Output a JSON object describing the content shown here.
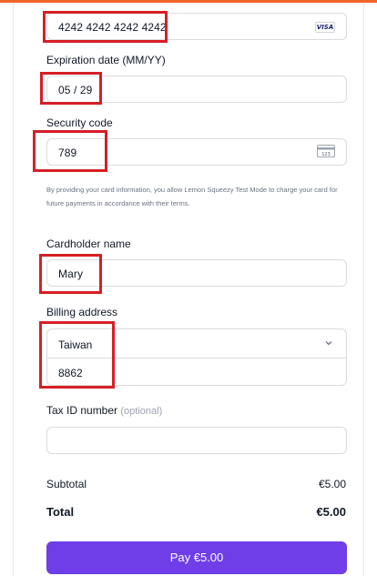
{
  "card": {
    "number": "4242 4242 4242 4242",
    "brand_badge": "VISA",
    "brand_icon": "visa-card-icon"
  },
  "expiration": {
    "label": "Expiration date (MM/YY)",
    "value": "05 / 29"
  },
  "security": {
    "label": "Security code",
    "value": "789",
    "icon": "cvc-card-icon",
    "icon_text": "123"
  },
  "disclaimer": "By providing your card information, you allow Lemon Squeezy Test Mode to charge your card for future payments in accordance with their terms.",
  "cardholder": {
    "label": "Cardholder name",
    "value": "Mary"
  },
  "billing": {
    "label": "Billing address",
    "country": "Taiwan",
    "postal": "8862",
    "chevron_icon": "chevron-down-icon"
  },
  "tax": {
    "label": "Tax ID number",
    "optional": "(optional)",
    "value": ""
  },
  "summary": {
    "subtotal_label": "Subtotal",
    "subtotal_value": "€5.00",
    "total_label": "Total",
    "total_value": "€5.00"
  },
  "pay_button": "Pay €5.00",
  "colors": {
    "accent": "#6f3ee8",
    "highlight": "#d61f26",
    "top_bar": "#f0632a"
  }
}
